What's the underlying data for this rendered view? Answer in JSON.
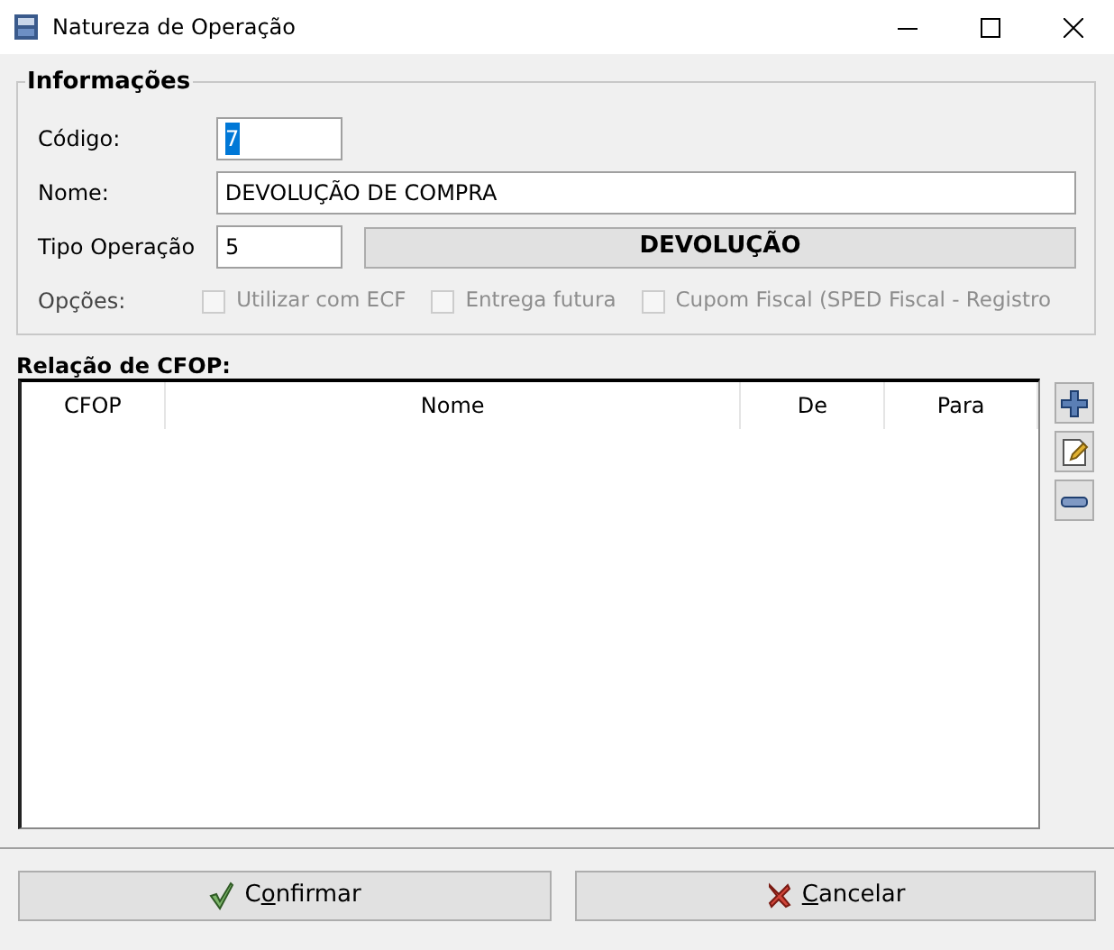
{
  "window": {
    "title": "Natureza de Operação"
  },
  "info": {
    "legend": "Informações",
    "fields": [
      {
        "label": "Código:",
        "value": "7",
        "text_selected": true
      },
      {
        "label": "Nome:",
        "value": "DEVOLUÇÃO DE COMPRA",
        "text_selected": false
      },
      {
        "label": "Tipo Operação",
        "value": "5",
        "text_selected": false,
        "description": "DEVOLUÇÃO"
      }
    ],
    "options": {
      "label": "Opções:",
      "items": [
        {
          "label": "Utilizar com ECF",
          "checked": false,
          "disabled": true
        },
        {
          "label": "Entrega futura",
          "checked": false,
          "disabled": true
        },
        {
          "label": "Cupom Fiscal (SPED Fiscal - Registro",
          "checked": false,
          "disabled": true
        }
      ]
    }
  },
  "cfop": {
    "title": "Relação de CFOP:",
    "columns": [
      "CFOP",
      "Nome",
      "De",
      "Para"
    ],
    "tools": [
      {
        "kind": "add"
      },
      {
        "kind": "edit"
      },
      {
        "kind": "remove"
      }
    ]
  },
  "buttons": [
    {
      "kind": "confirm",
      "label_parts": [
        "C",
        "o",
        "nfirmar"
      ],
      "mnemonic_first": false
    },
    {
      "kind": "cancel",
      "label_parts": [
        "C",
        "ancelar"
      ],
      "mnemonic_first": true
    }
  ]
}
